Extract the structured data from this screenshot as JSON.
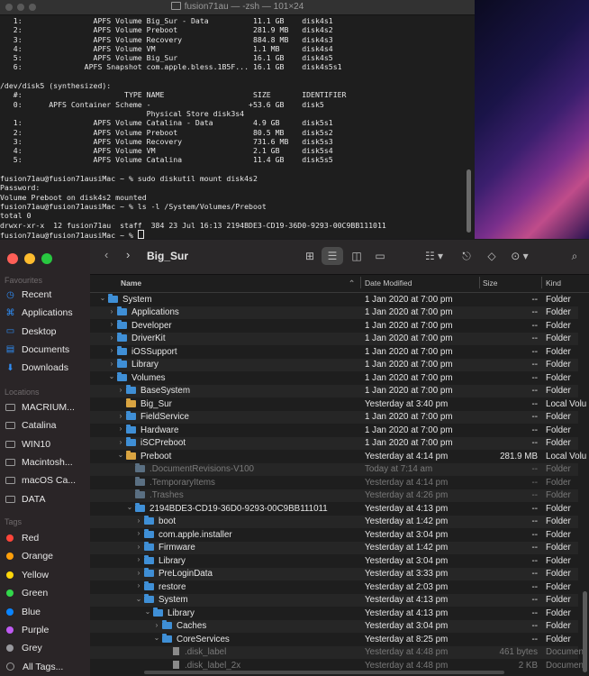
{
  "terminal": {
    "title": "fusion71au — -zsh — 101×24",
    "lines": [
      "   1:                APFS Volume Big_Sur - Data          11.1 GB    disk4s1",
      "   2:                APFS Volume Preboot                 281.9 MB   disk4s2",
      "   3:                APFS Volume Recovery                884.8 MB   disk4s3",
      "   4:                APFS Volume VM                      1.1 MB     disk4s4",
      "   5:                APFS Volume Big_Sur                 16.1 GB    disk4s5",
      "   6:              APFS Snapshot com.apple.bless.1B5F... 16.1 GB    disk4s5s1",
      "",
      "/dev/disk5 (synthesized):",
      "   #:                       TYPE NAME                    SIZE       IDENTIFIER",
      "   0:      APFS Container Scheme -                      +53.6 GB    disk5",
      "                                 Physical Store disk3s4",
      "   1:                APFS Volume Catalina - Data         4.9 GB     disk5s1",
      "   2:                APFS Volume Preboot                 80.5 MB    disk5s2",
      "   3:                APFS Volume Recovery                731.6 MB   disk5s3",
      "   4:                APFS Volume VM                      2.1 GB     disk5s4",
      "   5:                APFS Volume Catalina                11.4 GB    disk5s5",
      "",
      "fusion71au@fusion71ausiMac ~ % sudo diskutil mount disk4s2",
      "Password:",
      "Volume Preboot on disk4s2 mounted",
      "fusion71au@fusion71ausiMac ~ % ls -l /System/Volumes/Preboot",
      "total 0",
      "drwxr-xr-x  12 fusion71au  staff  384 23 Jul 16:13 2194BDE3-CD19-36D0-9293-00C9BB111011",
      "fusion71au@fusion71ausiMac ~ % "
    ]
  },
  "finder": {
    "title": "Big_Sur",
    "sidebar": {
      "favourites_heading": "Favourites",
      "favourites": [
        {
          "label": "Recent",
          "icon": "clock-icon"
        },
        {
          "label": "Applications",
          "icon": "applications-icon"
        },
        {
          "label": "Desktop",
          "icon": "desktop-icon"
        },
        {
          "label": "Documents",
          "icon": "document-icon"
        },
        {
          "label": "Downloads",
          "icon": "download-icon"
        }
      ],
      "locations_heading": "Locations",
      "locations": [
        {
          "label": "MACRIUM..."
        },
        {
          "label": "Catalina"
        },
        {
          "label": "WIN10"
        },
        {
          "label": "Macintosh..."
        },
        {
          "label": "macOS Ca..."
        },
        {
          "label": "DATA"
        }
      ],
      "tags_heading": "Tags",
      "tags": [
        {
          "label": "Red",
          "color": "#ff453a"
        },
        {
          "label": "Orange",
          "color": "#ff9f0a"
        },
        {
          "label": "Yellow",
          "color": "#ffd60a"
        },
        {
          "label": "Green",
          "color": "#32d74b"
        },
        {
          "label": "Blue",
          "color": "#0a84ff"
        },
        {
          "label": "Purple",
          "color": "#bf5af2"
        },
        {
          "label": "Grey",
          "color": "#98989d"
        },
        {
          "label": "All Tags...",
          "color": ""
        }
      ]
    },
    "columns": {
      "name": "Name",
      "date": "Date Modified",
      "size": "Size",
      "kind": "Kind"
    },
    "rows": [
      {
        "depth": 0,
        "chev": "down",
        "icon": "folder",
        "name": "System",
        "date": "1 Jan 2020 at 7:00 pm",
        "size": "--",
        "kind": "Folder"
      },
      {
        "depth": 1,
        "chev": "right",
        "icon": "folder",
        "name": "Applications",
        "date": "1 Jan 2020 at 7:00 pm",
        "size": "--",
        "kind": "Folder"
      },
      {
        "depth": 1,
        "chev": "right",
        "icon": "folder",
        "name": "Developer",
        "date": "1 Jan 2020 at 7:00 pm",
        "size": "--",
        "kind": "Folder"
      },
      {
        "depth": 1,
        "chev": "right",
        "icon": "folder",
        "name": "DriverKit",
        "date": "1 Jan 2020 at 7:00 pm",
        "size": "--",
        "kind": "Folder"
      },
      {
        "depth": 1,
        "chev": "right",
        "icon": "folder",
        "name": "iOSSupport",
        "date": "1 Jan 2020 at 7:00 pm",
        "size": "--",
        "kind": "Folder"
      },
      {
        "depth": 1,
        "chev": "right",
        "icon": "folder",
        "name": "Library",
        "date": "1 Jan 2020 at 7:00 pm",
        "size": "--",
        "kind": "Folder"
      },
      {
        "depth": 1,
        "chev": "down",
        "icon": "folder",
        "name": "Volumes",
        "date": "1 Jan 2020 at 7:00 pm",
        "size": "--",
        "kind": "Folder"
      },
      {
        "depth": 2,
        "chev": "right",
        "icon": "folder",
        "name": "BaseSystem",
        "date": "1 Jan 2020 at 7:00 pm",
        "size": "--",
        "kind": "Folder"
      },
      {
        "depth": 2,
        "chev": "",
        "icon": "disk",
        "name": "Big_Sur",
        "date": "Yesterday at 3:40 pm",
        "size": "--",
        "kind": "Local Volu"
      },
      {
        "depth": 2,
        "chev": "right",
        "icon": "folder",
        "name": "FieldService",
        "date": "1 Jan 2020 at 7:00 pm",
        "size": "--",
        "kind": "Folder"
      },
      {
        "depth": 2,
        "chev": "right",
        "icon": "folder",
        "name": "Hardware",
        "date": "1 Jan 2020 at 7:00 pm",
        "size": "--",
        "kind": "Folder"
      },
      {
        "depth": 2,
        "chev": "right",
        "icon": "folder",
        "name": "iSCPreboot",
        "date": "1 Jan 2020 at 7:00 pm",
        "size": "--",
        "kind": "Folder"
      },
      {
        "depth": 2,
        "chev": "down",
        "icon": "disk",
        "name": "Preboot",
        "date": "Yesterday at 4:14 pm",
        "size": "281.9 MB",
        "kind": "Local Volu"
      },
      {
        "depth": 3,
        "chev": "",
        "icon": "dimfolder",
        "name": ".DocumentRevisions-V100",
        "date": "Today at 7:14 am",
        "size": "--",
        "kind": "Folder",
        "dim": true
      },
      {
        "depth": 3,
        "chev": "",
        "icon": "dimfolder",
        "name": ".TemporaryItems",
        "date": "Yesterday at 4:14 pm",
        "size": "--",
        "kind": "Folder",
        "dim": true
      },
      {
        "depth": 3,
        "chev": "",
        "icon": "dimfolder",
        "name": ".Trashes",
        "date": "Yesterday at 4:26 pm",
        "size": "--",
        "kind": "Folder",
        "dim": true
      },
      {
        "depth": 3,
        "chev": "down",
        "icon": "folder",
        "name": "2194BDE3-CD19-36D0-9293-00C9BB111011",
        "date": "Yesterday at 4:13 pm",
        "size": "--",
        "kind": "Folder"
      },
      {
        "depth": 4,
        "chev": "right",
        "icon": "folder",
        "name": "boot",
        "date": "Yesterday at 1:42 pm",
        "size": "--",
        "kind": "Folder"
      },
      {
        "depth": 4,
        "chev": "right",
        "icon": "folder",
        "name": "com.apple.installer",
        "date": "Yesterday at 3:04 pm",
        "size": "--",
        "kind": "Folder"
      },
      {
        "depth": 4,
        "chev": "right",
        "icon": "folder",
        "name": "Firmware",
        "date": "Yesterday at 1:42 pm",
        "size": "--",
        "kind": "Folder"
      },
      {
        "depth": 4,
        "chev": "right",
        "icon": "folder",
        "name": "Library",
        "date": "Yesterday at 3:04 pm",
        "size": "--",
        "kind": "Folder"
      },
      {
        "depth": 4,
        "chev": "right",
        "icon": "folder",
        "name": "PreLoginData",
        "date": "Yesterday at 3:33 pm",
        "size": "--",
        "kind": "Folder"
      },
      {
        "depth": 4,
        "chev": "right",
        "icon": "folder",
        "name": "restore",
        "date": "Yesterday at 2:03 pm",
        "size": "--",
        "kind": "Folder"
      },
      {
        "depth": 4,
        "chev": "down",
        "icon": "folder",
        "name": "System",
        "date": "Yesterday at 4:13 pm",
        "size": "--",
        "kind": "Folder"
      },
      {
        "depth": 5,
        "chev": "down",
        "icon": "folder",
        "name": "Library",
        "date": "Yesterday at 4:13 pm",
        "size": "--",
        "kind": "Folder"
      },
      {
        "depth": 6,
        "chev": "right",
        "icon": "folder",
        "name": "Caches",
        "date": "Yesterday at 3:04 pm",
        "size": "--",
        "kind": "Folder"
      },
      {
        "depth": 6,
        "chev": "down",
        "icon": "folder",
        "name": "CoreServices",
        "date": "Yesterday at 8:25 pm",
        "size": "--",
        "kind": "Folder"
      },
      {
        "depth": 7,
        "chev": "",
        "icon": "file",
        "name": ".disk_label",
        "date": "Yesterday at 4:48 pm",
        "size": "461 bytes",
        "kind": "Documen",
        "dim": true
      },
      {
        "depth": 7,
        "chev": "",
        "icon": "file",
        "name": ".disk_label_2x",
        "date": "Yesterday at 4:48 pm",
        "size": "2 KB",
        "kind": "Documen",
        "dim": true
      }
    ]
  }
}
